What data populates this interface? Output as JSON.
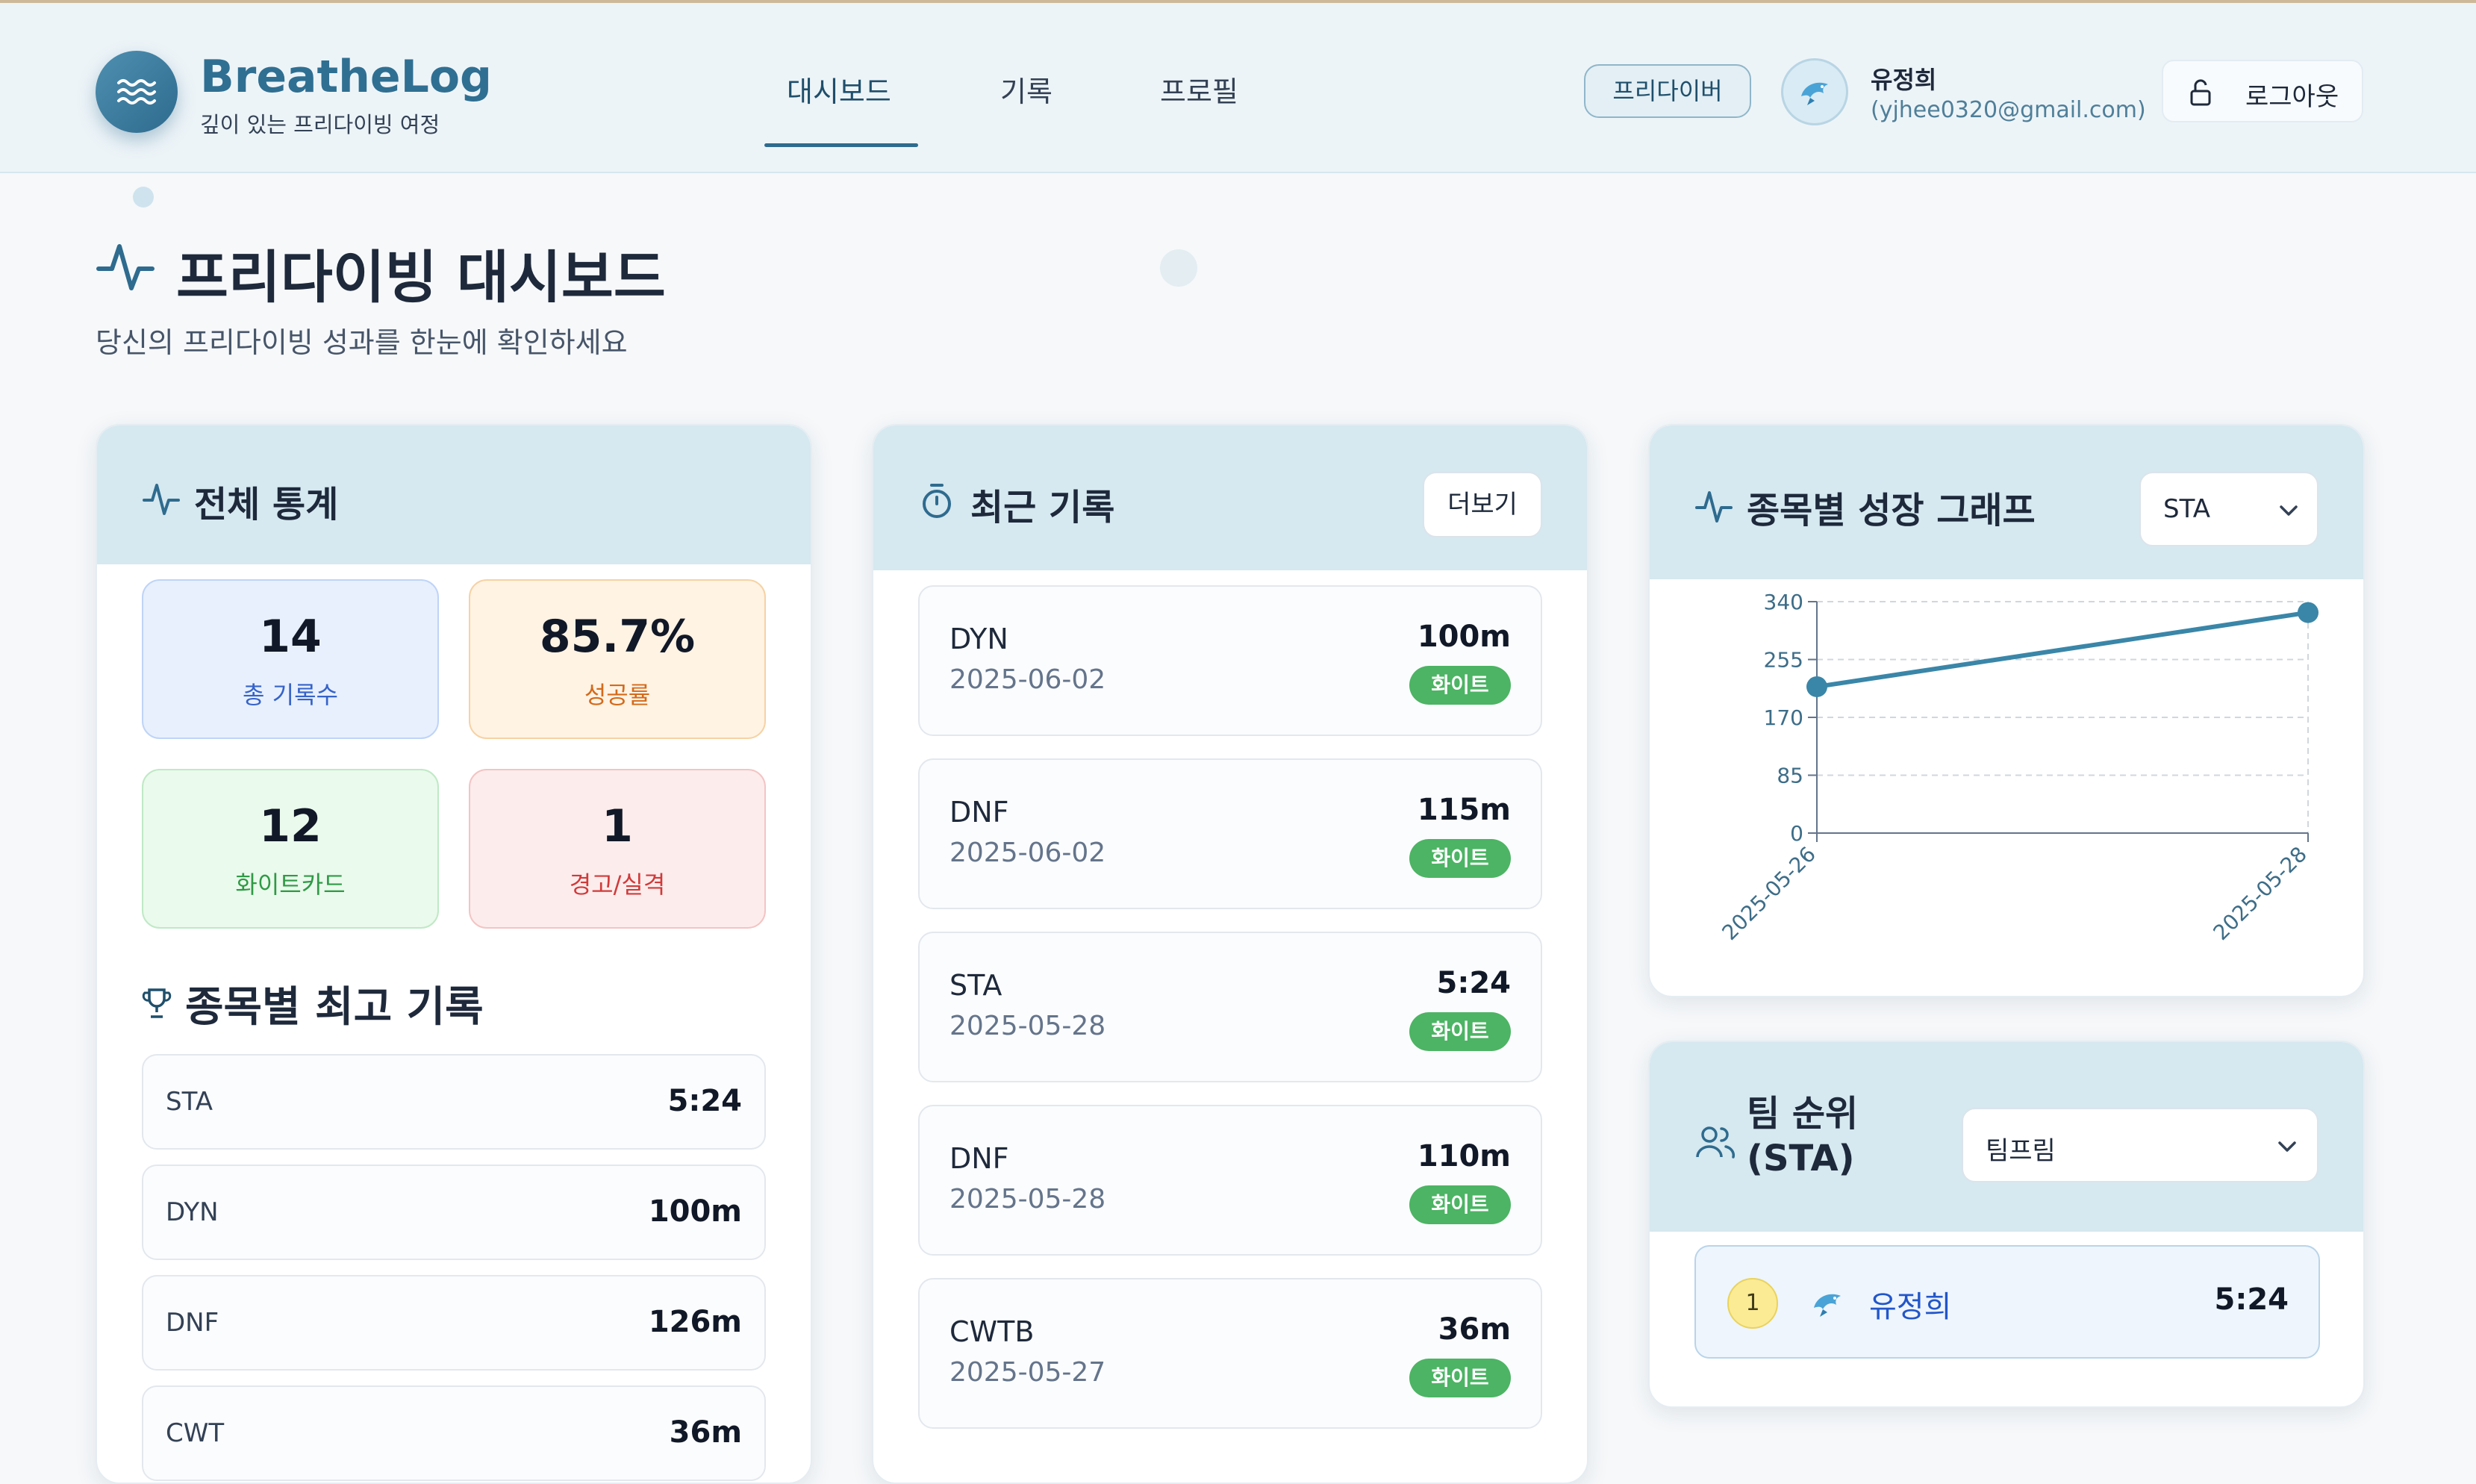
{
  "brand": {
    "name": "BreatheLog",
    "tagline": "깊이 있는 프리다이빙 여정"
  },
  "nav": {
    "items": [
      "대시보드",
      "기록",
      "프로필"
    ],
    "active": "대시보드"
  },
  "user": {
    "role": "프리다이버",
    "name": "유정희",
    "email": "(yjhee0320@gmail.com)",
    "logout": "로그아웃"
  },
  "page": {
    "title": "프리다이빙 대시보드",
    "subtitle": "당신의 프리다이빙 성과를 한눈에 확인하세요"
  },
  "stats": {
    "title": "전체 통계",
    "cards": [
      {
        "value": "14",
        "label": "총 기록수"
      },
      {
        "value": "85.7%",
        "label": "성공률"
      },
      {
        "value": "12",
        "label": "화이트카드"
      },
      {
        "value": "1",
        "label": "경고/실격"
      }
    ]
  },
  "best": {
    "title": "종목별 최고 기록",
    "rows": [
      {
        "name": "STA",
        "value": "5:24"
      },
      {
        "name": "DYN",
        "value": "100m"
      },
      {
        "name": "DNF",
        "value": "126m"
      },
      {
        "name": "CWT",
        "value": "36m"
      }
    ]
  },
  "recent": {
    "title": "최근 기록",
    "more": "더보기",
    "rows": [
      {
        "name": "DYN",
        "date": "2025-06-02",
        "value": "100m",
        "badge": "화이트"
      },
      {
        "name": "DNF",
        "date": "2025-06-02",
        "value": "115m",
        "badge": "화이트"
      },
      {
        "name": "STA",
        "date": "2025-05-28",
        "value": "5:24",
        "badge": "화이트"
      },
      {
        "name": "DNF",
        "date": "2025-05-28",
        "value": "110m",
        "badge": "화이트"
      },
      {
        "name": "CWTB",
        "date": "2025-05-27",
        "value": "36m",
        "badge": "화이트"
      }
    ]
  },
  "growth": {
    "title": "종목별 성장 그래프",
    "selected": "STA"
  },
  "chart_data": {
    "type": "line",
    "x": [
      "2025-05-26",
      "2025-05-28"
    ],
    "values": [
      215,
      324
    ],
    "yticks": [
      "0",
      "85",
      "170",
      "255",
      "340"
    ],
    "ylim": [
      0,
      340
    ],
    "grid": true,
    "color": "#3a86a8"
  },
  "team": {
    "title_line1": "팀 순위",
    "title_line2": "(STA)",
    "selected": "팀프림",
    "rows": [
      {
        "rank": "1",
        "name": "유정희",
        "value": "5:24"
      }
    ]
  }
}
